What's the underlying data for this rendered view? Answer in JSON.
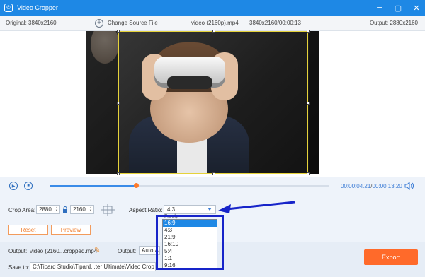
{
  "window": {
    "title": "Video Cropper",
    "app_icon_glyph": "©",
    "minimize": "─",
    "maximize": "▢",
    "close": "✕"
  },
  "info": {
    "original": "Original: 3840x2160",
    "change_source": "Change Source File",
    "filename": "video (2160p).mp4",
    "meta": "3840x2160/00:00:13",
    "output_res": "Output: 2880x2160"
  },
  "playback": {
    "current": "00:00:04.21",
    "total": "00:00:13.20",
    "progress": 0.31
  },
  "crop": {
    "label": "Crop Area:",
    "width": "2880",
    "height": "2160",
    "aspect_label": "Aspect Ratio:",
    "aspect_value": "4:3",
    "aspect_peek": "Freely",
    "reset": "Reset",
    "preview": "Preview"
  },
  "dropdown": {
    "options": [
      "16:9",
      "4:3",
      "21:9",
      "16:10",
      "5:4",
      "1:1",
      "9:16"
    ],
    "selected_index": 0
  },
  "output": {
    "label": "Output:",
    "filename": "video (2160...cropped.mp4",
    "settings_label": "Output:",
    "settings_value": "Auto;Auto",
    "saveto_label": "Save to:",
    "path": "C:\\Tipard Studio\\Tipard...ter Ultimate\\Video Crop",
    "export": "Export"
  },
  "colors": {
    "accent": "#1e88e5",
    "export": "#ff6a2a",
    "annotation": "#1724c9"
  }
}
